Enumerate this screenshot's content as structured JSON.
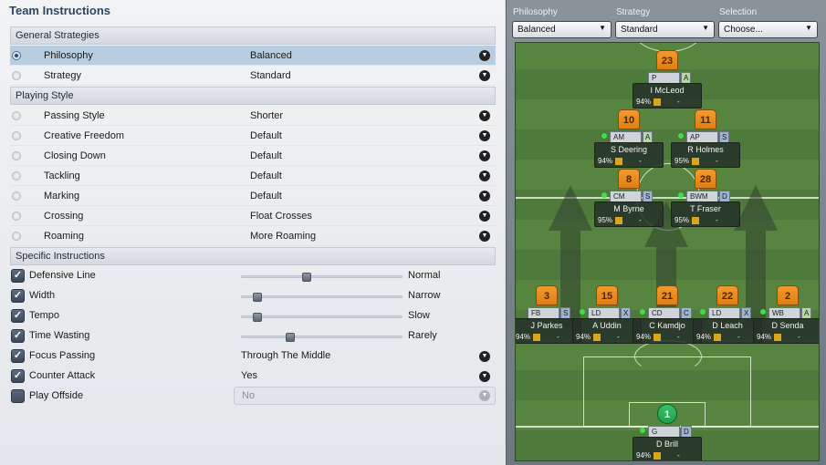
{
  "title": "Team Instructions",
  "sections": {
    "general": "General Strategies",
    "playing": "Playing Style",
    "specific": "Specific Instructions"
  },
  "general": [
    {
      "label": "Philosophy",
      "value": "Balanced",
      "selected": true
    },
    {
      "label": "Strategy",
      "value": "Standard",
      "selected": false
    }
  ],
  "playing": [
    {
      "label": "Passing Style",
      "value": "Shorter"
    },
    {
      "label": "Creative Freedom",
      "value": "Default"
    },
    {
      "label": "Closing Down",
      "value": "Default"
    },
    {
      "label": "Tackling",
      "value": "Default"
    },
    {
      "label": "Marking",
      "value": "Default"
    },
    {
      "label": "Crossing",
      "value": "Float Crosses"
    },
    {
      "label": "Roaming",
      "value": "More Roaming"
    }
  ],
  "specific": [
    {
      "label": "Defensive Line",
      "type": "slider",
      "value": "Normal",
      "level": 0.4,
      "checked": true
    },
    {
      "label": "Width",
      "type": "slider",
      "value": "Narrow",
      "level": 0.1,
      "checked": true
    },
    {
      "label": "Tempo",
      "type": "slider",
      "value": "Slow",
      "level": 0.1,
      "checked": true
    },
    {
      "label": "Time Wasting",
      "type": "slider",
      "value": "Rarely",
      "level": 0.3,
      "checked": true
    },
    {
      "label": "Focus Passing",
      "type": "dropdown",
      "value": "Through The Middle",
      "checked": true
    },
    {
      "label": "Counter Attack",
      "type": "dropdown",
      "value": "Yes",
      "checked": true
    },
    {
      "label": "Play Offside",
      "type": "disabled",
      "value": "No",
      "checked": false
    }
  ],
  "panel": {
    "philosophy_label": "Philosophy",
    "philosophy_value": "Balanced",
    "strategy_label": "Strategy",
    "strategy_value": "Standard",
    "selection_label": "Selection",
    "selection_value": "Choose..."
  },
  "players": [
    {
      "num": "23",
      "role": "P",
      "duty": "A",
      "name": "I McLeod",
      "cond": "94%"
    },
    {
      "num": "10",
      "role": "AM",
      "duty": "A",
      "name": "S Deering",
      "cond": "94%"
    },
    {
      "num": "11",
      "role": "AP",
      "duty": "S",
      "name": "R Holmes",
      "cond": "95%"
    },
    {
      "num": "8",
      "role": "CM",
      "duty": "S",
      "name": "M Byrne",
      "cond": "95%"
    },
    {
      "num": "28",
      "role": "BWM",
      "duty": "D",
      "name": "T Fraser",
      "cond": "95%"
    },
    {
      "num": "3",
      "role": "FB",
      "duty": "S",
      "name": "J Parkes",
      "cond": "94%"
    },
    {
      "num": "15",
      "role": "LD",
      "duty": "X",
      "name": "A Uddin",
      "cond": "94%"
    },
    {
      "num": "21",
      "role": "CD",
      "duty": "C",
      "name": "C Kamdjo",
      "cond": "94%"
    },
    {
      "num": "22",
      "role": "LD",
      "duty": "X",
      "name": "D Leach",
      "cond": "94%"
    },
    {
      "num": "2",
      "role": "WB",
      "duty": "A",
      "name": "D Senda",
      "cond": "94%"
    },
    {
      "num": "1",
      "role": "G",
      "duty": "D",
      "name": "D Brill",
      "cond": "94%"
    }
  ],
  "dash": "-",
  "check": "✓"
}
